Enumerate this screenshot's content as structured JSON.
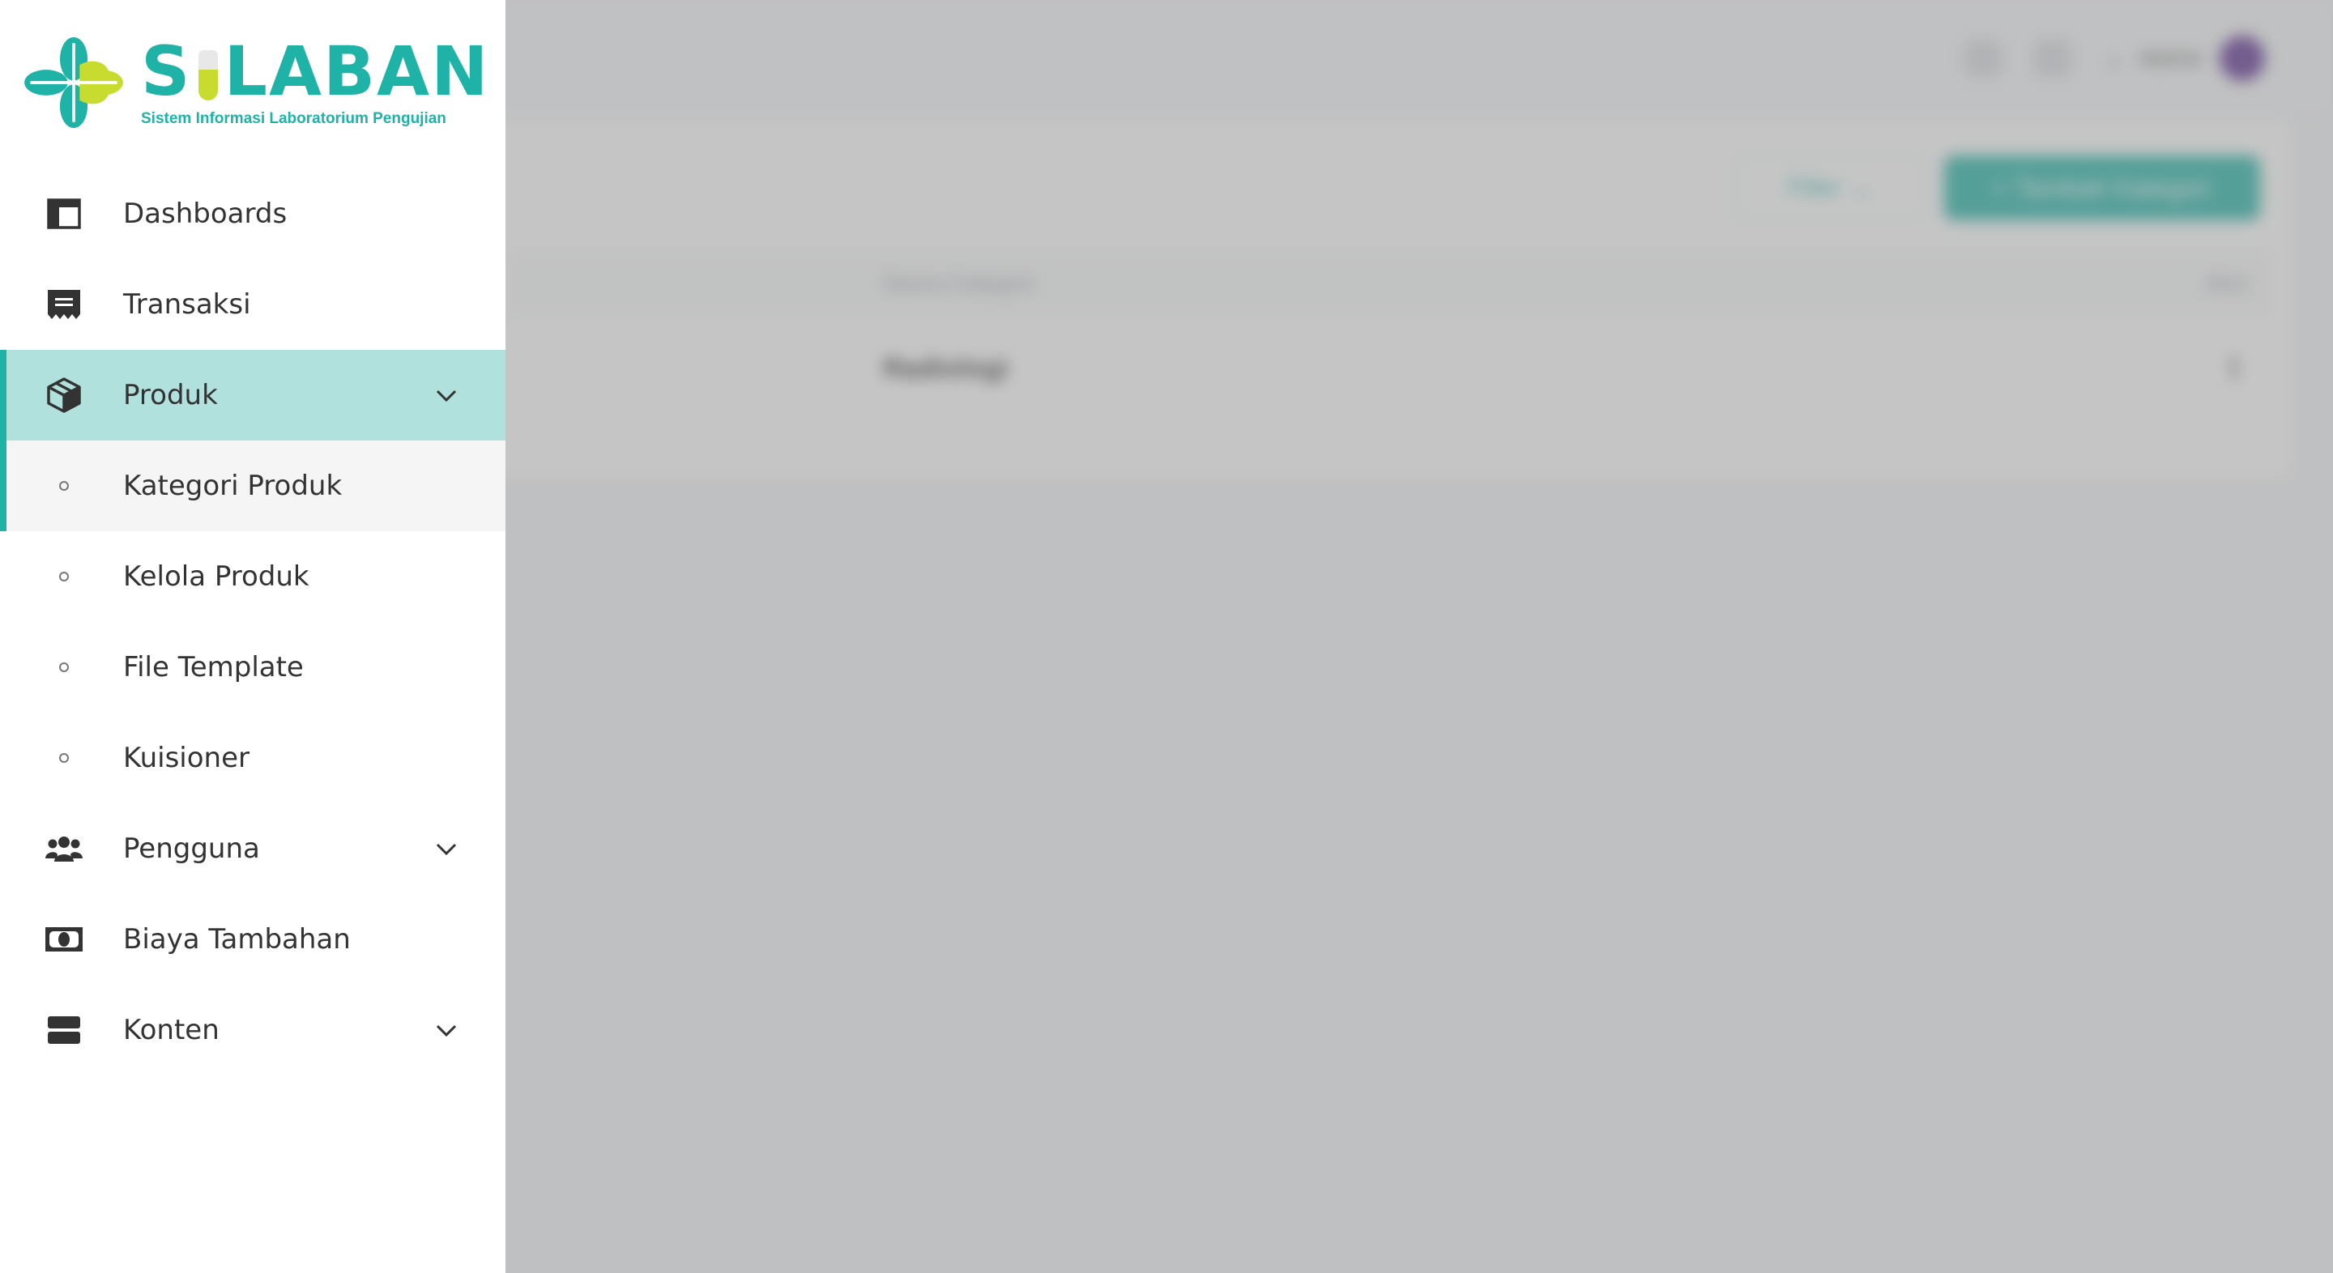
{
  "app": {
    "title": "SILABAN",
    "subtitle": "Sistem Informasi Laboratorium Pengujian",
    "brand_color": "#1fb2a6",
    "accent_color": "#c8dc2f"
  },
  "sidebar": {
    "items": [
      {
        "label": "Dashboards",
        "icon": "dashboard-icon"
      },
      {
        "label": "Transaksi",
        "icon": "receipt-icon"
      },
      {
        "label": "Produk",
        "icon": "box-icon",
        "expanded": true
      },
      {
        "label": "Kategori Produk",
        "icon": "bullet-icon",
        "current": true
      },
      {
        "label": "Kelola Produk",
        "icon": "bullet-icon"
      },
      {
        "label": "File Template",
        "icon": "bullet-icon"
      },
      {
        "label": "Kuisioner",
        "icon": "bullet-icon"
      },
      {
        "label": "Pengguna",
        "icon": "users-icon"
      },
      {
        "label": "Biaya Tambahan",
        "icon": "money-icon"
      },
      {
        "label": "Konten",
        "icon": "layers-icon"
      }
    ]
  },
  "background": {
    "topbar": {
      "user_name": "Admin"
    },
    "toolbar": {
      "filter_label": "Filter",
      "add_label": "+ Tambah Kategori"
    },
    "table": {
      "headers": [
        "Nama Kategori",
        "Aksi"
      ],
      "rows": [
        [
          "Radiologi",
          "⋮"
        ]
      ]
    }
  }
}
